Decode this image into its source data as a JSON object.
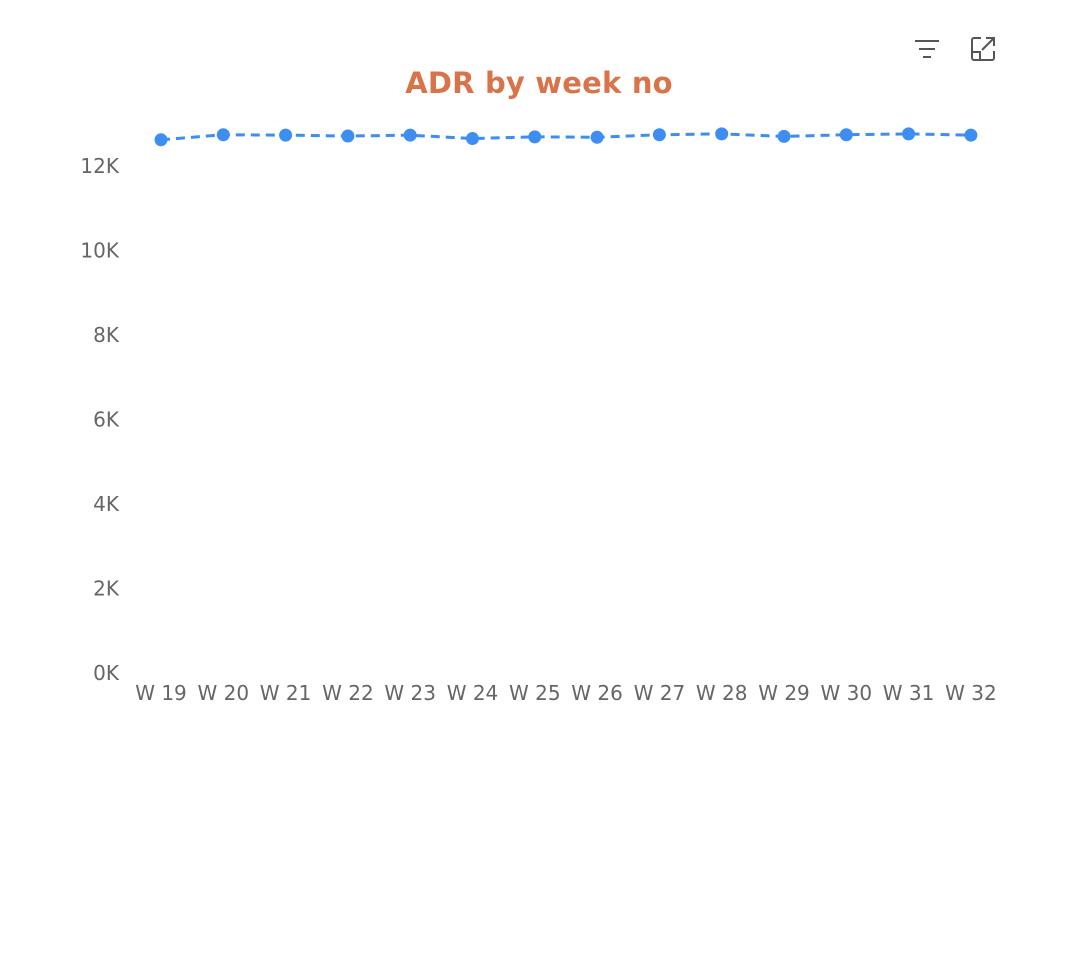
{
  "toolbar": {
    "filter_icon": "filter-icon",
    "focus_icon": "focus-mode-icon"
  },
  "colors": {
    "title": "#D9734A",
    "series": "#3E8EF2",
    "tick_text": "#666666"
  },
  "chart_data": {
    "type": "line",
    "title": "ADR by week no",
    "xlabel": "",
    "ylabel": "",
    "categories": [
      "W 19",
      "W 20",
      "W 21",
      "W 22",
      "W 23",
      "W 24",
      "W 25",
      "W 26",
      "W 27",
      "W 28",
      "W 29",
      "W 30",
      "W 31",
      "W 32"
    ],
    "series": [
      {
        "values": [
          12620,
          12740,
          12730,
          12710,
          12730,
          12650,
          12690,
          12680,
          12740,
          12760,
          12700,
          12740,
          12760,
          12730
        ],
        "line_style": "dashed",
        "markers": true
      }
    ],
    "ylim": [
      0,
      12800
    ],
    "yticks": [
      0,
      2000,
      4000,
      6000,
      8000,
      10000,
      12000
    ],
    "ytick_labels": [
      "0K",
      "2K",
      "4K",
      "6K",
      "8K",
      "10K",
      "12K"
    ],
    "grid": false,
    "legend": "none"
  }
}
